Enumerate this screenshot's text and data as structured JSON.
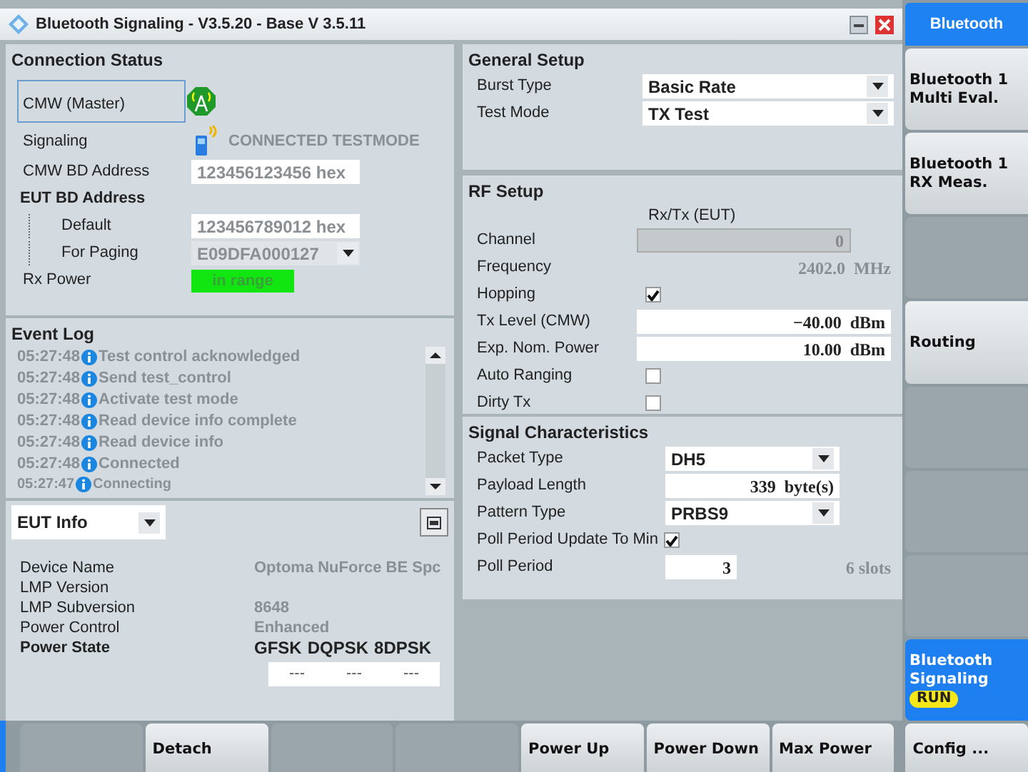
{
  "window": {
    "title": "Bluetooth Signaling  - V3.5.20 - Base V 3.5.11"
  },
  "connection_status": {
    "title": "Connection Status",
    "cmw_role": "CMW (Master)",
    "signaling": {
      "label": "Signaling",
      "value": "CONNECTED TESTMODE"
    },
    "cmw_bd_address": {
      "label": "CMW BD Address",
      "value": "123456123456",
      "unit": "hex"
    },
    "eut_bd_address": {
      "label": "EUT BD Address",
      "children": [
        {
          "label": "Default",
          "kind": "field",
          "value": "123456789012",
          "unit": "hex",
          "disabled": false
        },
        {
          "label": "For Paging",
          "kind": "dropdown",
          "value": "E09DFA000127",
          "disabled": true
        }
      ]
    },
    "rx_power": {
      "label": "Rx Power",
      "value": "in range"
    }
  },
  "event_log": {
    "title": "Event Log",
    "entries": [
      {
        "time": "05:27:48",
        "text": "Test control acknowledged"
      },
      {
        "time": "05:27:48",
        "text": "Send test_control"
      },
      {
        "time": "05:27:48",
        "text": "Activate test mode"
      },
      {
        "time": "05:27:48",
        "text": "Read device info complete"
      },
      {
        "time": "05:27:48",
        "text": "Read device info"
      },
      {
        "time": "05:27:48",
        "text": "Connected"
      },
      {
        "time": "05:27:47",
        "text": "Connecting"
      }
    ]
  },
  "eut_info": {
    "selector": "EUT Info",
    "rows": [
      {
        "label": "Device Name",
        "value": "Optoma NuForce BE Spc"
      },
      {
        "label": "LMP Version"
      },
      {
        "label": "LMP Subversion",
        "value": "8648"
      },
      {
        "label": "Power Control",
        "value": "Enhanced"
      }
    ],
    "power_state": {
      "label": "Power State",
      "columns": [
        "GFSK",
        "DQPSK",
        "8DPSK"
      ],
      "values": [
        "---",
        "---",
        "---"
      ]
    }
  },
  "general_setup": {
    "title": "General Setup",
    "rows": [
      {
        "label": "Burst Type",
        "value": "Basic Rate"
      },
      {
        "label": "Test Mode",
        "value": "TX Test"
      }
    ]
  },
  "rf_setup": {
    "title": "RF Setup",
    "column_header": "Rx/Tx (EUT)",
    "rows": [
      {
        "kind": "field",
        "label": "Channel",
        "value": "0",
        "disabled": true
      },
      {
        "kind": "readout",
        "label": "Frequency",
        "value": "2402.0",
        "unit": "MHz"
      },
      {
        "kind": "checkbox",
        "label": "Hopping",
        "checked": true
      },
      {
        "kind": "field",
        "label": "Tx Level (CMW)",
        "value": "−40.00",
        "unit": "dBm",
        "disabled": false
      },
      {
        "kind": "field",
        "label": "Exp. Nom. Power",
        "value": "10.00",
        "unit": "dBm",
        "disabled": false
      },
      {
        "kind": "checkbox",
        "label": "Auto Ranging",
        "checked": false
      },
      {
        "kind": "checkbox",
        "label": "Dirty Tx",
        "checked": false
      }
    ]
  },
  "signal_characteristics": {
    "title": "Signal Characteristics",
    "rows": [
      {
        "kind": "dropdown",
        "label": "Packet Type",
        "value": "DH5"
      },
      {
        "kind": "field",
        "label": "Payload Length",
        "value": "339",
        "unit": "byte(s)"
      },
      {
        "kind": "dropdown",
        "label": "Pattern Type",
        "value": "PRBS9"
      },
      {
        "kind": "checkbox",
        "label": "Poll Period Update To Min",
        "checked": true
      },
      {
        "kind": "field",
        "label": "Poll Period",
        "value": "3",
        "note": "6 slots"
      }
    ]
  },
  "sidebar": {
    "header": "Bluetooth",
    "items": [
      {
        "kind": "key",
        "label": "Bluetooth 1\nMulti Eval.",
        "selected": false
      },
      {
        "kind": "key",
        "label": "Bluetooth 1\nRX Meas.",
        "selected": false
      },
      {
        "kind": "blank",
        "selected": false
      },
      {
        "kind": "key",
        "label": "Routing",
        "selected": false
      },
      {
        "kind": "blank",
        "selected": false
      },
      {
        "kind": "blank",
        "selected": false
      },
      {
        "kind": "blank",
        "selected": false
      },
      {
        "kind": "key",
        "label": "Bluetooth\nSignaling",
        "badge": "RUN",
        "selected": true
      }
    ]
  },
  "softkeys": [
    {
      "kind": "blank"
    },
    {
      "kind": "key",
      "label": "Detach"
    },
    {
      "kind": "blank"
    },
    {
      "kind": "blank"
    },
    {
      "kind": "key",
      "label": "Power Up"
    },
    {
      "kind": "key",
      "label": "Power Down"
    },
    {
      "kind": "key",
      "label": "Max Power"
    },
    {
      "kind": "key",
      "label": "Config ..."
    }
  ]
}
